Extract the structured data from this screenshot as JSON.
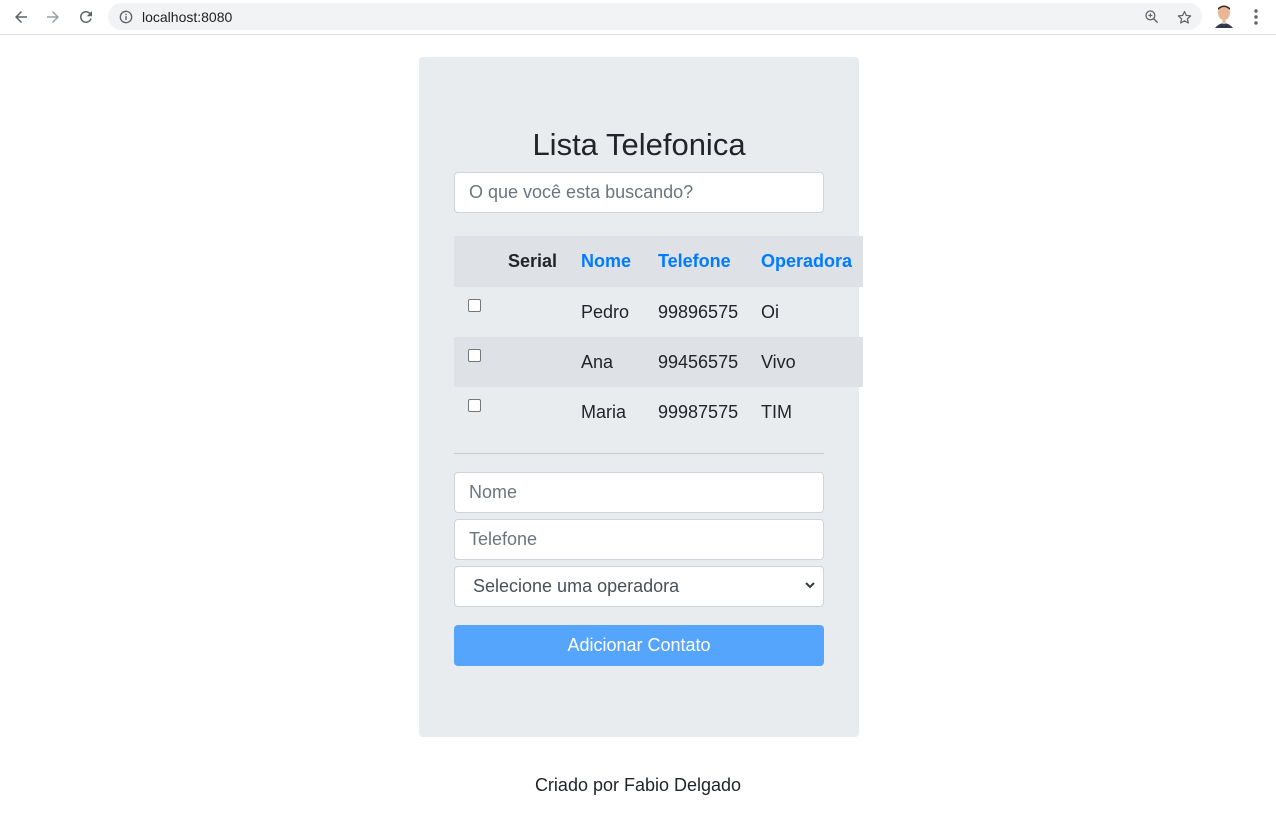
{
  "browser": {
    "url": "localhost:8080"
  },
  "app": {
    "title": "Lista Telefonica",
    "search_placeholder": "O que você esta buscando?",
    "table": {
      "headers": {
        "serial": "Serial",
        "nome": "Nome",
        "telefone": "Telefone",
        "operadora": "Operadora"
      },
      "rows": [
        {
          "nome": "Pedro",
          "telefone": "99896575",
          "operadora": "Oi"
        },
        {
          "nome": "Ana",
          "telefone": "99456575",
          "operadora": "Vivo"
        },
        {
          "nome": "Maria",
          "telefone": "99987575",
          "operadora": "TIM"
        }
      ]
    },
    "form": {
      "nome_placeholder": "Nome",
      "telefone_placeholder": "Telefone",
      "operadora_selected": "Selecione uma operadora",
      "submit_label": "Adicionar Contato"
    },
    "footer": "Criado por Fabio Delgado"
  },
  "colors": {
    "card_bg": "#e9ecef",
    "link_blue": "#007bff",
    "button_blue": "#55a5fd"
  }
}
